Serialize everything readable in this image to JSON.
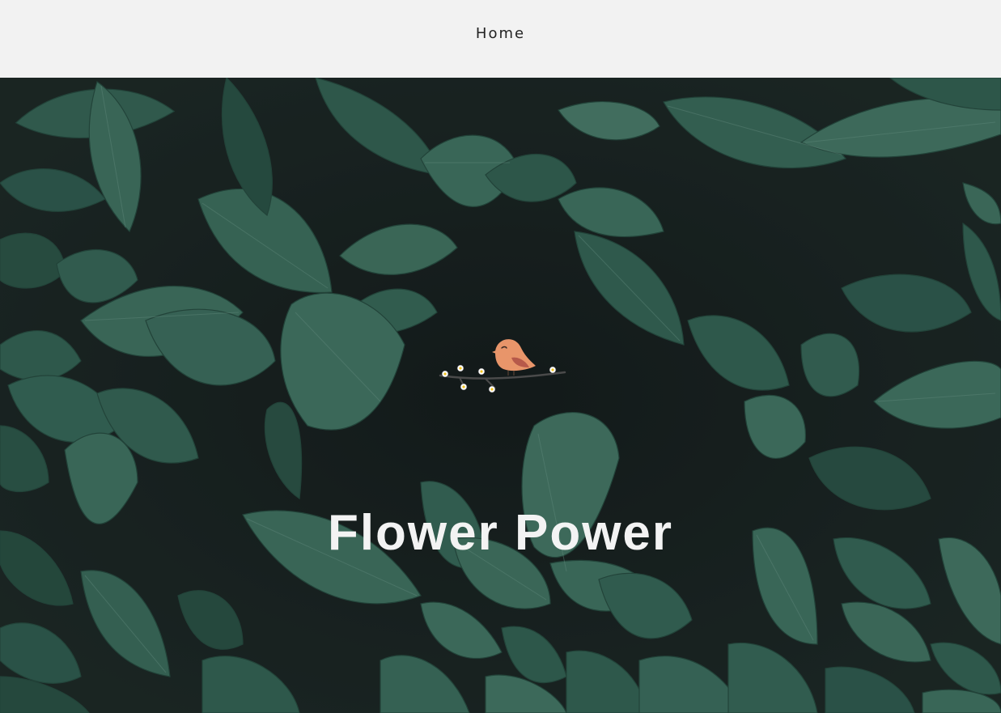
{
  "nav": {
    "home_label": "Home"
  },
  "hero": {
    "title": "Flower Power",
    "background_image": "leaves-photo",
    "logo_icon": "bird-on-branch-icon"
  },
  "colors": {
    "nav_background": "#f2f2f2",
    "nav_text": "#222222",
    "hero_background": "#1c2624",
    "leaf_green": "#3e7663",
    "title_text": "#f3f3f3",
    "bird_orange": "#e8956a"
  }
}
